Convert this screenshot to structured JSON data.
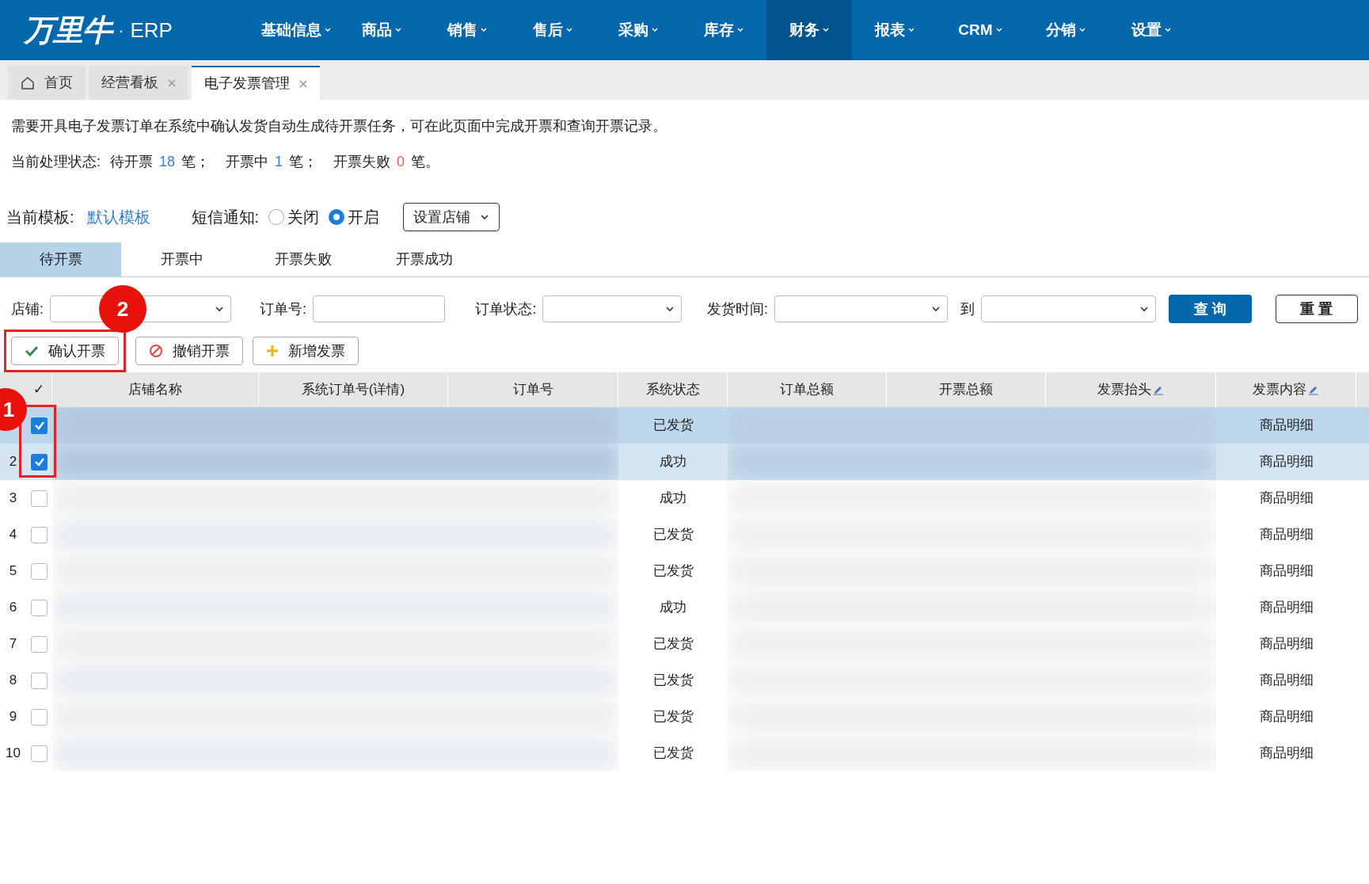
{
  "brand": {
    "logo": "万里牛",
    "dot": "·",
    "product": "ERP"
  },
  "nav": [
    {
      "label": "基础信息",
      "selected": false
    },
    {
      "label": "商品",
      "selected": false
    },
    {
      "label": "销售",
      "selected": false
    },
    {
      "label": "售后",
      "selected": false
    },
    {
      "label": "采购",
      "selected": false
    },
    {
      "label": "库存",
      "selected": false
    },
    {
      "label": "财务",
      "selected": true
    },
    {
      "label": "报表",
      "selected": false
    },
    {
      "label": "CRM",
      "selected": false
    },
    {
      "label": "分销",
      "selected": false
    },
    {
      "label": "设置",
      "selected": false
    }
  ],
  "page_tabs": [
    {
      "label": "首页",
      "kind": "home",
      "selected": false
    },
    {
      "label": "经营看板",
      "kind": "closable",
      "selected": false
    },
    {
      "label": "电子发票管理",
      "kind": "closable",
      "selected": true
    }
  ],
  "intro": "需要开具电子发票订单在系统中确认发货自动生成待开票任务，可在此页面中完成开票和查询开票记录。",
  "status": {
    "label": "当前处理状态:",
    "items": [
      {
        "label": "待开票",
        "count": "18",
        "color": "#3b82d6",
        "unit": "笔；"
      },
      {
        "label": "开票中",
        "count": "1",
        "color": "#3b82d6",
        "unit": "笔；"
      },
      {
        "label": "开票失败",
        "count": "0",
        "color": "#f05a4a",
        "unit": "笔。"
      }
    ]
  },
  "template": {
    "label": "当前模板:",
    "value": "默认模板"
  },
  "sms": {
    "label": "短信通知:",
    "options": [
      {
        "label": "关闭",
        "selected": false
      },
      {
        "label": "开启",
        "selected": true
      }
    ]
  },
  "store_setting_button": "设置店铺",
  "status_tabs": [
    {
      "label": "待开票",
      "selected": true
    },
    {
      "label": "开票中",
      "selected": false
    },
    {
      "label": "开票失败",
      "selected": false
    },
    {
      "label": "开票成功",
      "selected": false
    }
  ],
  "filters": {
    "store": {
      "label": "店铺:"
    },
    "order_no": {
      "label": "订单号:"
    },
    "order_status": {
      "label": "订单状态:"
    },
    "ship_time": {
      "label": "发货时间:",
      "to": "到"
    },
    "search_button": "查 询",
    "reset_button": "重 置"
  },
  "actions": [
    {
      "label": "确认开票",
      "kind": "confirm"
    },
    {
      "label": "撤销开票",
      "kind": "cancel"
    },
    {
      "label": "新增发票",
      "kind": "add"
    }
  ],
  "table": {
    "columns": [
      "✓",
      "店铺名称",
      "系统订单号(详情)",
      "订单号",
      "系统状态",
      "订单总额",
      "开票总额",
      "发票抬头",
      "发票内容"
    ],
    "rows": [
      {
        "checked": true,
        "status": "已发货",
        "content": "商品明细"
      },
      {
        "index": "2",
        "checked": true,
        "status": "成功",
        "content": "商品明细"
      },
      {
        "index": "3",
        "checked": false,
        "status": "成功",
        "content": "商品明细"
      },
      {
        "index": "4",
        "checked": false,
        "status": "已发货",
        "content": "商品明细"
      },
      {
        "index": "5",
        "checked": false,
        "status": "已发货",
        "content": "商品明细"
      },
      {
        "index": "6",
        "checked": false,
        "status": "成功",
        "content": "商品明细"
      },
      {
        "index": "7",
        "checked": false,
        "status": "已发货",
        "content": "商品明细"
      },
      {
        "index": "8",
        "checked": false,
        "status": "已发货",
        "content": "商品明细"
      },
      {
        "index": "9",
        "checked": false,
        "status": "已发货",
        "content": "商品明细"
      },
      {
        "index": "10",
        "checked": false,
        "status": "已发货",
        "content": "商品明细"
      }
    ]
  },
  "annotations": [
    {
      "label": "1"
    },
    {
      "label": "2"
    }
  ]
}
